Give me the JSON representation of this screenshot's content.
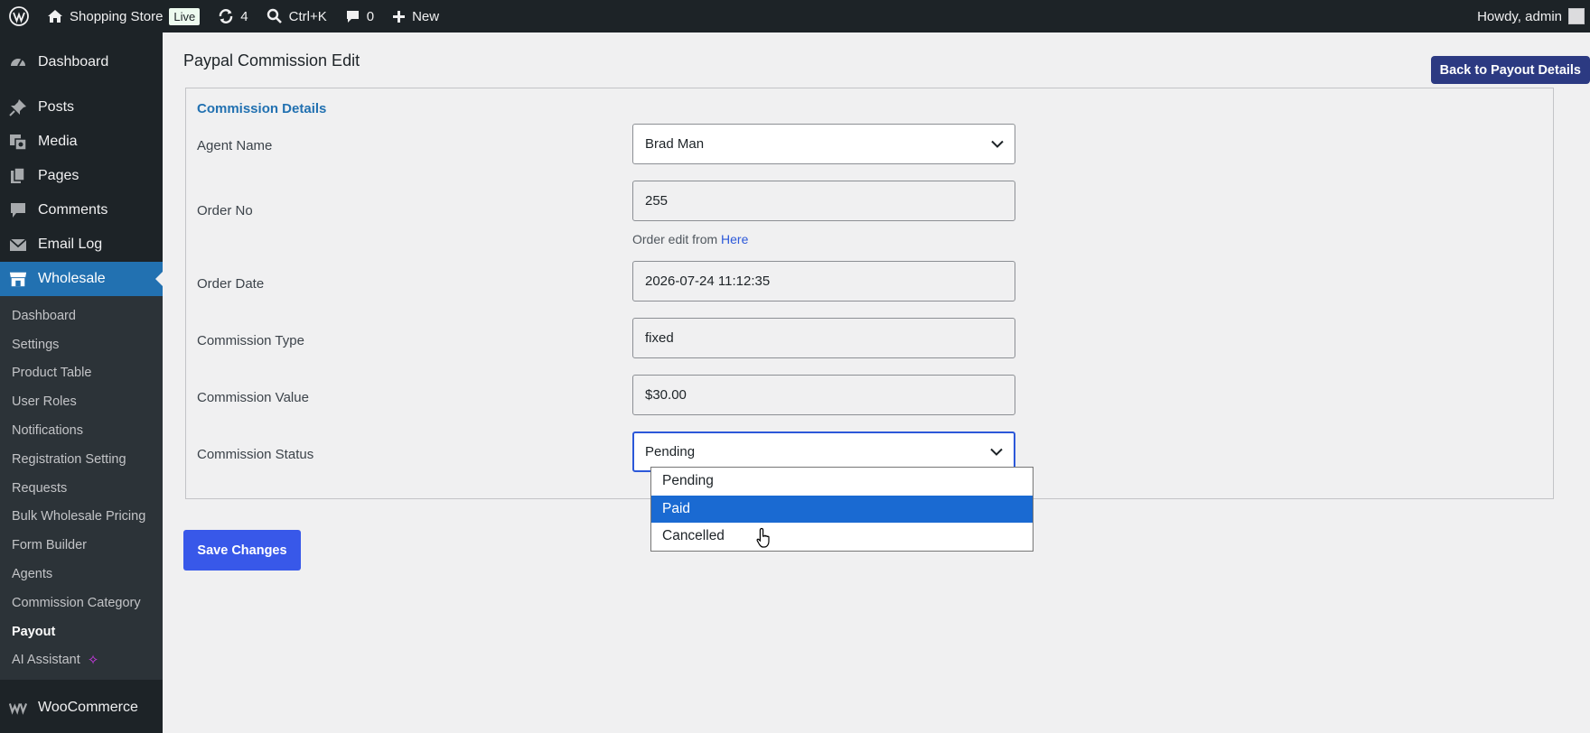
{
  "adminbar": {
    "site_name": "Shopping Store",
    "live_badge": "Live",
    "updates_count": "4",
    "search_shortcut": "Ctrl+K",
    "comments_count": "0",
    "new_label": "New",
    "greeting": "Howdy, admin"
  },
  "sidebar": {
    "menu": [
      {
        "label": "Dashboard",
        "icon": "dashboard-icon"
      },
      {
        "label": "Posts",
        "icon": "pin-icon"
      },
      {
        "label": "Media",
        "icon": "media-icon"
      },
      {
        "label": "Pages",
        "icon": "pages-icon"
      },
      {
        "label": "Comments",
        "icon": "comment-icon"
      },
      {
        "label": "Email Log",
        "icon": "email-icon"
      },
      {
        "label": "Wholesale",
        "icon": "store-icon"
      }
    ],
    "submenu": [
      "Dashboard",
      "Settings",
      "Product Table",
      "User Roles",
      "Notifications",
      "Registration Setting",
      "Requests",
      "Bulk Wholesale Pricing",
      "Form Builder",
      "Agents",
      "Commission Category",
      "Payout",
      "AI Assistant"
    ],
    "current_submenu": "Payout",
    "woocommerce_label": "WooCommerce"
  },
  "page": {
    "title": "Paypal Commission Edit",
    "back_button": "Back to Payout Details",
    "panel_title": "Commission Details",
    "fields": {
      "agent_name": {
        "label": "Agent Name",
        "value": "Brad Man"
      },
      "order_no": {
        "label": "Order No",
        "value": "255",
        "help_prefix": "Order edit from",
        "help_link": "Here"
      },
      "order_date": {
        "label": "Order Date",
        "value": "2026-07-24 11:12:35"
      },
      "commission_type": {
        "label": "Commission Type",
        "value": "fixed"
      },
      "commission_value": {
        "label": "Commission Value",
        "value": "$30.00"
      },
      "commission_status": {
        "label": "Commission Status",
        "value": "Pending",
        "options": [
          "Pending",
          "Paid",
          "Cancelled"
        ],
        "highlighted": "Paid"
      }
    },
    "save_button": "Save Changes"
  },
  "colors": {
    "adminbar_bg": "#1d2327",
    "active_menu": "#2271b1",
    "primary_button": "#3858e9",
    "back_button": "#2c3a82",
    "dropdown_highlight": "#1a6ad2",
    "panel_title": "#2271b1"
  }
}
